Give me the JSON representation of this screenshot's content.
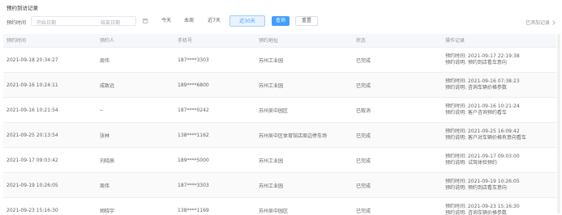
{
  "page": {
    "title": "预约到访记录"
  },
  "filter": {
    "label": "预约时间",
    "date_start_placeholder": "开始日期",
    "date_end_placeholder": "结束日期",
    "segments": [
      "今天",
      "本周",
      "近7天",
      "近30天"
    ],
    "active_segment": "近30天",
    "query_label": "查询",
    "reset_label": "重置"
  },
  "header_link": {
    "label": "已添加记录"
  },
  "table": {
    "columns": [
      "预约时间",
      "预约人",
      "手机号",
      "预约地址",
      "状态",
      "操作记录"
    ],
    "rows": [
      {
        "time": "2021-09-18 20:34:27",
        "name": "周伟",
        "phone": "187****3303",
        "addr": "苏州工业园",
        "status": "已完成",
        "rec1": "预约时间: 2021-09-17 22:19:38",
        "rec2": "预约说明: 预约到店看车意向"
      },
      {
        "time": "2021-09-16 10:24:11",
        "name": "成致远",
        "phone": "189****6800",
        "addr": "苏州工业园",
        "status": "已完成",
        "rec1": "预约时间: 2021-09-16 07:38:23",
        "rec2": "预约说明: 咨询车辆价格参数"
      },
      {
        "time": "2021-09-16 10:21:54",
        "name": "--",
        "phone": "187****0242",
        "addr": "苏州吴中园区",
        "status": "已取消",
        "rec1": "预约时间: 2021-09-16 10:21:24",
        "rec2": "预约说明: 客户咨询预约看车"
      },
      {
        "time": "2021-09-25 20:13:54",
        "name": "张林",
        "phone": "138****1162",
        "addr": "苏州吴中区体育馆店周边停车场",
        "status": "已完成",
        "rec1": "预约时间: 2021-09-25 16:09:42",
        "rec2": "预约说明: 客户对车辆价格有意向看车"
      },
      {
        "time": "2021-09-17 09:03:42",
        "name": "刘晓辰",
        "phone": "189****5000",
        "addr": "苏州工业园",
        "status": "已完成",
        "rec1": "预约时间: 2021-09-17 09:03:00",
        "rec2": "预约说明: 试驾体验预约"
      },
      {
        "time": "2021-09-19 10:26:05",
        "name": "周伟",
        "phone": "187****3303",
        "addr": "苏州工业园",
        "status": "已完成",
        "rec1": "预约时间: 2021-09-19 10:26:05",
        "rec2": "预约说明: 预约到店看车意向"
      },
      {
        "time": "2021-09-23 15:16:30",
        "name": "胡晓宇",
        "phone": "138****1169",
        "addr": "苏州吴中园区",
        "status": "已完成",
        "rec1": "预约时间: 2021-09-23 15:16:30",
        "rec2": "预约说明: 咨询车辆价格参数"
      }
    ]
  }
}
